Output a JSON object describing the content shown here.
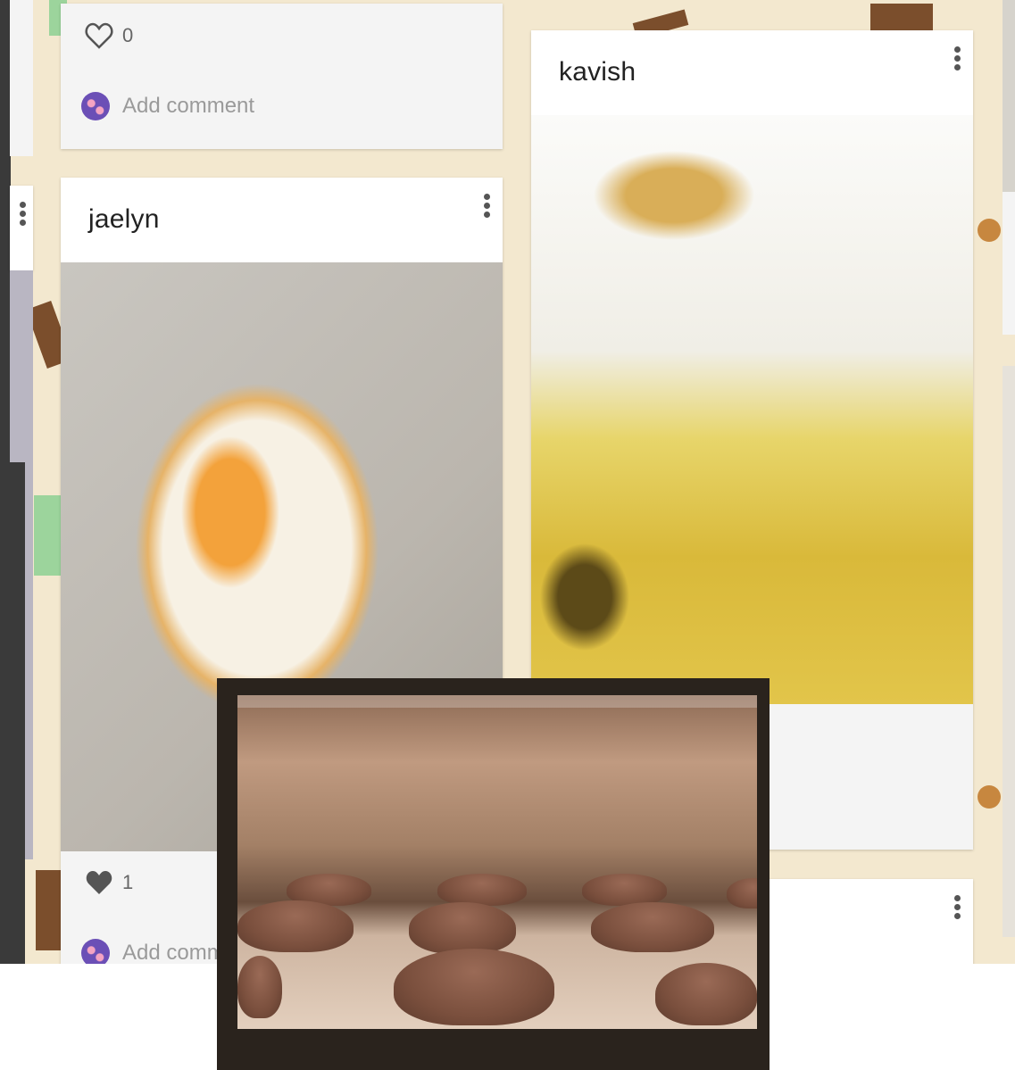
{
  "cards": [
    {
      "id": "top-card",
      "likes": "0",
      "comment_placeholder": "Add comment"
    },
    {
      "id": "jaelyn-card",
      "author": "jaelyn",
      "likes": "1",
      "comment_placeholder": "Add comm"
    },
    {
      "id": "kavish-card",
      "author": "kavish"
    }
  ],
  "icons": {
    "like_empty": "heart-outline-icon",
    "like_filled": "heart-filled-icon",
    "menu": "kebab-menu-icon",
    "avatar": "user-avatar"
  },
  "colors": {
    "board_background": "#f3e8cf",
    "card_background": "#f4f4f4",
    "card_header": "#ffffff",
    "author_text": "#222222",
    "muted_text": "#9a9a9a"
  }
}
